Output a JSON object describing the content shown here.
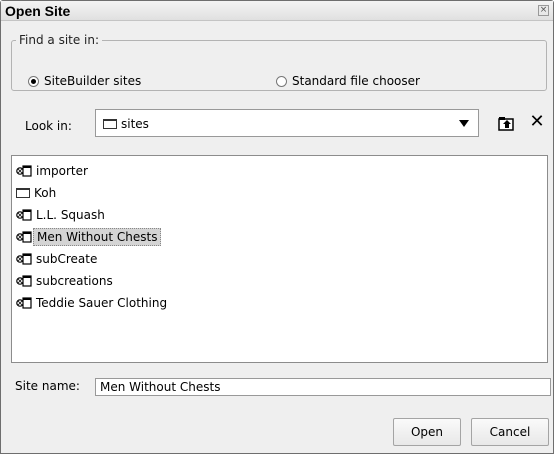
{
  "window": {
    "title": "Open Site",
    "close_glyph": "×"
  },
  "find_group": {
    "legend": "Find a site in:",
    "options": [
      {
        "label": "SiteBuilder sites",
        "selected": true
      },
      {
        "label": "Standard file chooser",
        "selected": false
      }
    ]
  },
  "look_in": {
    "label": "Look in:",
    "value": "sites",
    "close_glyph": "✕"
  },
  "files": [
    {
      "name": "importer",
      "type": "site"
    },
    {
      "name": "Koh",
      "type": "folder"
    },
    {
      "name": "L.L. Squash",
      "type": "site"
    },
    {
      "name": "Men Without Chests",
      "type": "site",
      "selected": true
    },
    {
      "name": "subCreate",
      "type": "site"
    },
    {
      "name": "subcreations",
      "type": "site"
    },
    {
      "name": "Teddie Sauer Clothing",
      "type": "site"
    }
  ],
  "site_name": {
    "label": "Site name:",
    "value": "Men Without Chests"
  },
  "buttons": {
    "open": "Open",
    "cancel": "Cancel"
  }
}
